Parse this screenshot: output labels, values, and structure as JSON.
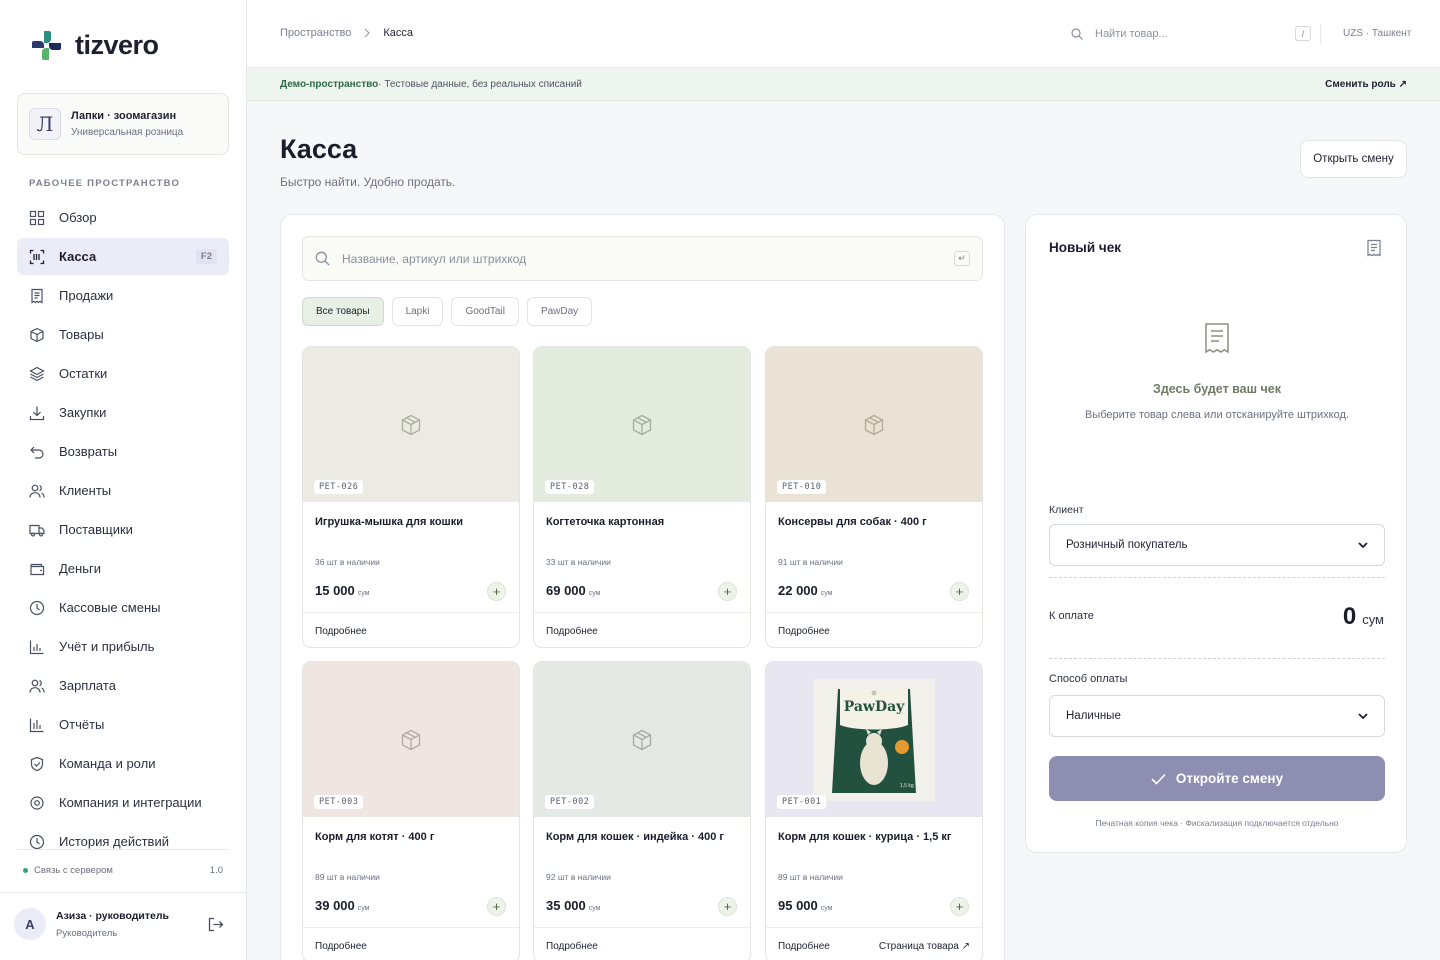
{
  "brand": {
    "name": "tizvero",
    "colors": {
      "teal": "#2d8f7b",
      "navy": "#1e2a5a",
      "green": "#58b36a"
    }
  },
  "store": {
    "initial": "Л",
    "name": "Лапки · зоомагазин",
    "type": "Универсальная розница"
  },
  "sidebar": {
    "section_label": "РАБОЧЕЕ ПРОСТРАНСТВО",
    "items": [
      {
        "label": "Обзор",
        "icon": "grid-icon"
      },
      {
        "label": "Касса",
        "icon": "scan-icon",
        "shortcut": "F2",
        "active": true
      },
      {
        "label": "Продажи",
        "icon": "receipt-icon"
      },
      {
        "label": "Товары",
        "icon": "box-icon"
      },
      {
        "label": "Остатки",
        "icon": "layers-icon"
      },
      {
        "label": "Закупки",
        "icon": "download-icon"
      },
      {
        "label": "Возвраты",
        "icon": "undo-icon"
      },
      {
        "label": "Клиенты",
        "icon": "users-icon"
      },
      {
        "label": "Поставщики",
        "icon": "truck-icon"
      },
      {
        "label": "Деньги",
        "icon": "wallet-icon"
      },
      {
        "label": "Кассовые смены",
        "icon": "clock-icon"
      },
      {
        "label": "Учёт и прибыль",
        "icon": "bar-chart-icon"
      },
      {
        "label": "Зарплата",
        "icon": "user-group-icon"
      },
      {
        "label": "Отчёты",
        "icon": "report-chart-icon"
      },
      {
        "label": "Команда и роли",
        "icon": "shield-icon"
      },
      {
        "label": "Компания и интеграции",
        "icon": "settings-icon"
      },
      {
        "label": "История действий",
        "icon": "history-icon"
      }
    ],
    "status": "Связь с сервером",
    "version": "1.0"
  },
  "user": {
    "initial": "А",
    "name": "Азиза · руководитель",
    "role": "Руководитель"
  },
  "topbar": {
    "breadcrumb": [
      "Пространство",
      "Касса"
    ],
    "search_placeholder": "Найти товар...",
    "search_key": "/",
    "locale": "UZS · Ташкент"
  },
  "banner": {
    "title": "Демо-пространство",
    "text": " · Тестовые данные, без реальных списаний",
    "action": "Сменить роль ↗"
  },
  "page": {
    "title": "Касса",
    "subtitle": "Быстро найти. Удобно продать.",
    "open_shift": "Открыть смену"
  },
  "catalog": {
    "search_placeholder": "Название, артикул или штрихкод",
    "search_key": "↵",
    "filters": [
      "Все товары",
      "Lapki",
      "GoodTail",
      "PawDay"
    ],
    "active_filter": "Все товары",
    "products": [
      {
        "sku": "PET-026",
        "name": "Игрушка-мышка для кошки",
        "stock": "36 шт в наличии",
        "price": "15 000",
        "currency": "сум",
        "details": "Подробнее",
        "bg": "#ebebe4"
      },
      {
        "sku": "PET-028",
        "name": "Когтеточка картонная",
        "stock": "33 шт в наличии",
        "price": "69 000",
        "currency": "сум",
        "details": "Подробнее",
        "bg": "#e4ebdf"
      },
      {
        "sku": "PET-010",
        "name": "Консервы для собак · 400 г",
        "stock": "91 шт в наличии",
        "price": "22 000",
        "currency": "сум",
        "details": "Подробнее",
        "bg": "#ebe2d6"
      },
      {
        "sku": "PET-003",
        "name": "Корм для котят · 400 г",
        "stock": "89 шт в наличии",
        "price": "39 000",
        "currency": "сум",
        "details": "Подробнее",
        "bg": "#efe6e1"
      },
      {
        "sku": "PET-002",
        "name": "Корм для кошек · индейка · 400 г",
        "stock": "92 шт в наличии",
        "price": "35 000",
        "currency": "сум",
        "details": "Подробнее",
        "bg": "#e5e9e6"
      },
      {
        "sku": "PET-001",
        "name": "Корм для кошек · курица · 1,5 кг",
        "stock": "89 шт в наличии",
        "price": "95 000",
        "currency": "сум",
        "details": "Подробнее",
        "product_page": "Страница товара ↗",
        "bg": "#e8e6f0",
        "package_brand": "PawDay",
        "package_weight": "1,5 kg"
      }
    ]
  },
  "receipt": {
    "title": "Новый чек",
    "empty_title": "Здесь будет ваш чек",
    "empty_sub": "Выберите товар слева или отсканируйте штрихкод.",
    "client_label": "Клиент",
    "client_value": "Розничный покупатель",
    "total_label": "К оплате",
    "total_value": "0",
    "total_currency": "сум",
    "payment_label": "Способ оплаты",
    "payment_value": "Наличные",
    "cta": "Откройте смену",
    "note": "Печатная копия чека · Фискализация подключается отдельно"
  }
}
